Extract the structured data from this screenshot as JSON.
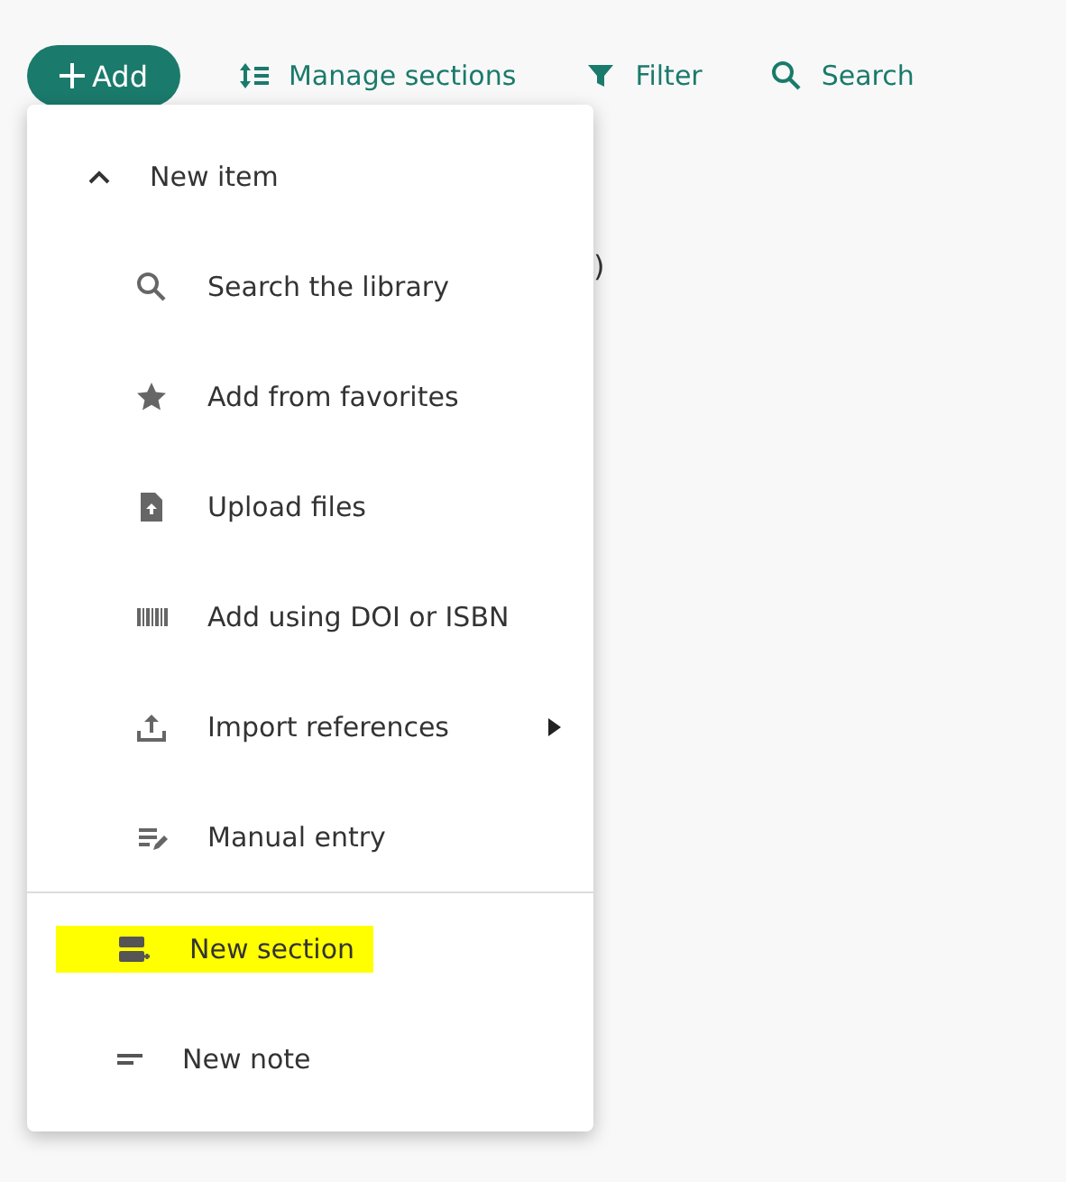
{
  "toolbar": [
    {
      "label": "Add",
      "kind": "add"
    },
    {
      "label": "Manage sections",
      "kind": "sort"
    },
    {
      "label": "Filter",
      "kind": "filter"
    },
    {
      "label": "Search",
      "kind": "search"
    }
  ],
  "background_text": ")",
  "menu": {
    "group": {
      "label": "New item",
      "expanded": true,
      "items": [
        {
          "label": "Search the library",
          "kind": "search",
          "submenu": false
        },
        {
          "label": "Add from favorites",
          "kind": "star",
          "submenu": false
        },
        {
          "label": "Upload files",
          "kind": "upload",
          "submenu": false
        },
        {
          "label": "Add using DOI or ISBN",
          "kind": "barcode",
          "submenu": false
        },
        {
          "label": "Import references",
          "kind": "import",
          "submenu": true
        },
        {
          "label": "Manual entry",
          "kind": "manual",
          "submenu": false
        }
      ]
    },
    "items": [
      {
        "label": "New section",
        "kind": "section",
        "highlighted": true
      },
      {
        "label": "New note",
        "kind": "note",
        "highlighted": false
      }
    ]
  }
}
